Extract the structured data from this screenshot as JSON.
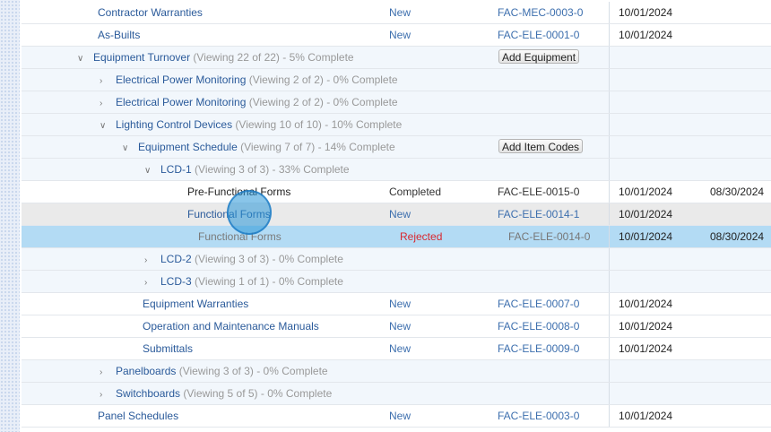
{
  "rows": [
    {
      "name": "Contractor Warranties",
      "status": "New",
      "code": "FAC-MEC-0003-0",
      "date": "10/01/2024"
    },
    {
      "name": "As-Builts",
      "status": "New",
      "code": "FAC-ELE-0001-0",
      "date": "10/01/2024"
    },
    {
      "name": "Equipment Turnover",
      "meta": "(Viewing 22 of 22) - 5% Complete",
      "button": "Add Equipment"
    },
    {
      "name": "Electrical Power Monitoring",
      "meta": "(Viewing 2 of 2) - 0% Complete"
    },
    {
      "name": "Electrical Power Monitoring",
      "meta": "(Viewing 2 of 2) - 0% Complete"
    },
    {
      "name": "Lighting Control Devices",
      "meta": "(Viewing 10 of 10) - 10% Complete"
    },
    {
      "name": "Equipment Schedule",
      "meta": "(Viewing 7 of 7) - 14% Complete",
      "button": "Add Item Codes"
    },
    {
      "name": "LCD-1",
      "meta": "(Viewing 3 of 3) - 33% Complete"
    },
    {
      "name": "Pre-Functional Forms",
      "status": "Completed",
      "code": "FAC-ELE-0015-0",
      "date": "10/01/2024",
      "due": "08/30/2024"
    },
    {
      "name": "Functional Forms",
      "status": "New",
      "code": "FAC-ELE-0014-1",
      "date": "10/01/2024"
    },
    {
      "name": "Functional Forms",
      "status": "Rejected",
      "code": "FAC-ELE-0014-0",
      "date": "10/01/2024",
      "due": "08/30/2024"
    },
    {
      "name": "LCD-2",
      "meta": "(Viewing 3 of 3) - 0% Complete"
    },
    {
      "name": "LCD-3",
      "meta": "(Viewing 1 of 1) - 0% Complete"
    },
    {
      "name": "Equipment Warranties",
      "status": "New",
      "code": "FAC-ELE-0007-0",
      "date": "10/01/2024"
    },
    {
      "name": "Operation and Maintenance Manuals",
      "status": "New",
      "code": "FAC-ELE-0008-0",
      "date": "10/01/2024"
    },
    {
      "name": "Submittals",
      "status": "New",
      "code": "FAC-ELE-0009-0",
      "date": "10/01/2024"
    },
    {
      "name": "Panelboards",
      "meta": "(Viewing 3 of 3) - 0% Complete"
    },
    {
      "name": "Switchboards",
      "meta": "(Viewing 5 of 5) - 0% Complete"
    },
    {
      "name": "Panel Schedules",
      "status": "New",
      "code": "FAC-ELE-0003-0",
      "date": "10/01/2024"
    }
  ],
  "icons": {
    "expanded": "chevron-down-icon",
    "collapsed": "chevron-right-icon"
  },
  "colors": {
    "link": "#3d6fae",
    "rejected": "#d9272e",
    "selected_row": "#b3dbf4",
    "group_row": "#f2f7fc"
  }
}
